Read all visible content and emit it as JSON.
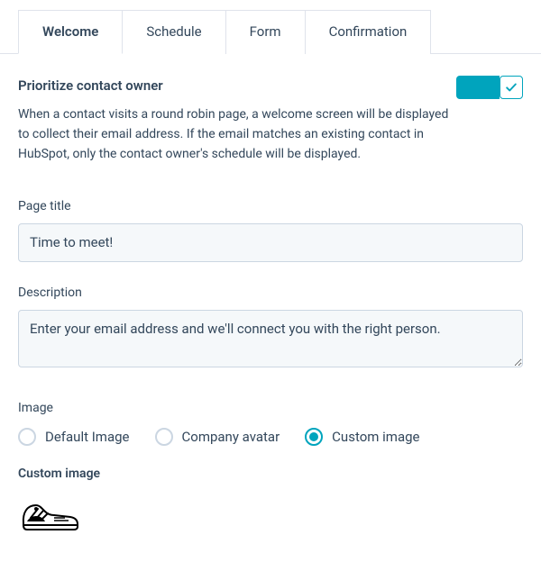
{
  "tabs": [
    {
      "label": "Welcome",
      "active": true
    },
    {
      "label": "Schedule",
      "active": false
    },
    {
      "label": "Form",
      "active": false
    },
    {
      "label": "Confirmation",
      "active": false
    }
  ],
  "prioritize": {
    "title": "Prioritize contact owner",
    "description": "When a contact visits a round robin page, a welcome screen will be displayed to collect their email address. If the email matches an existing contact in HubSpot, only the contact owner's schedule will be displayed.",
    "enabled": true
  },
  "pageTitle": {
    "label": "Page title",
    "value": "Time to meet!"
  },
  "description": {
    "label": "Description",
    "value": "Enter your email address and we'll connect you with the right person."
  },
  "image": {
    "label": "Image",
    "options": [
      {
        "label": "Default Image",
        "value": "default",
        "selected": false
      },
      {
        "label": "Company avatar",
        "value": "company",
        "selected": false
      },
      {
        "label": "Custom image",
        "value": "custom",
        "selected": true
      }
    ],
    "customLabel": "Custom image"
  },
  "colors": {
    "accent": "#00a4bd",
    "border": "#cbd6e2",
    "text": "#33475b",
    "inputBg": "#f5f8fa"
  }
}
